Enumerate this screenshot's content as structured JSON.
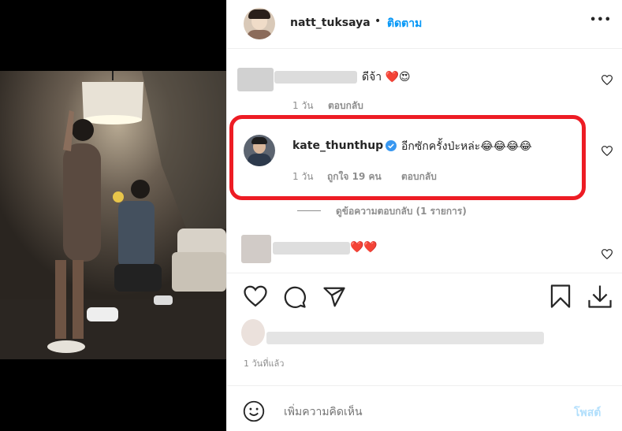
{
  "header": {
    "username": "natt_tuksaya",
    "separator": "•",
    "follow_label": "ติดตาม",
    "more_label": "•••"
  },
  "comments": [
    {
      "text": "ดีจ้า ❤️😍",
      "time": "1 วัน",
      "reply_label": "ตอบกลับ"
    },
    {
      "username": "kate_thunthup",
      "text": "อีกซักครั้งป่ะหล่ะ😂😂😂😂",
      "time": "1 วัน",
      "likes_label": "ถูกใจ 19 คน",
      "reply_label": "ตอบกลับ",
      "view_replies": "ดูข้อความตอบกลับ (1 รายการ)"
    },
    {
      "text": "❤️❤️"
    }
  ],
  "post": {
    "time_ago": "1 วันที่แล้ว"
  },
  "composer": {
    "placeholder": "เพิ่มความคิดเห็น",
    "post_label": "โพสต์"
  },
  "colors": {
    "accent": "#0095f6",
    "highlight": "#ed1c24",
    "verified": "#3897f0"
  }
}
